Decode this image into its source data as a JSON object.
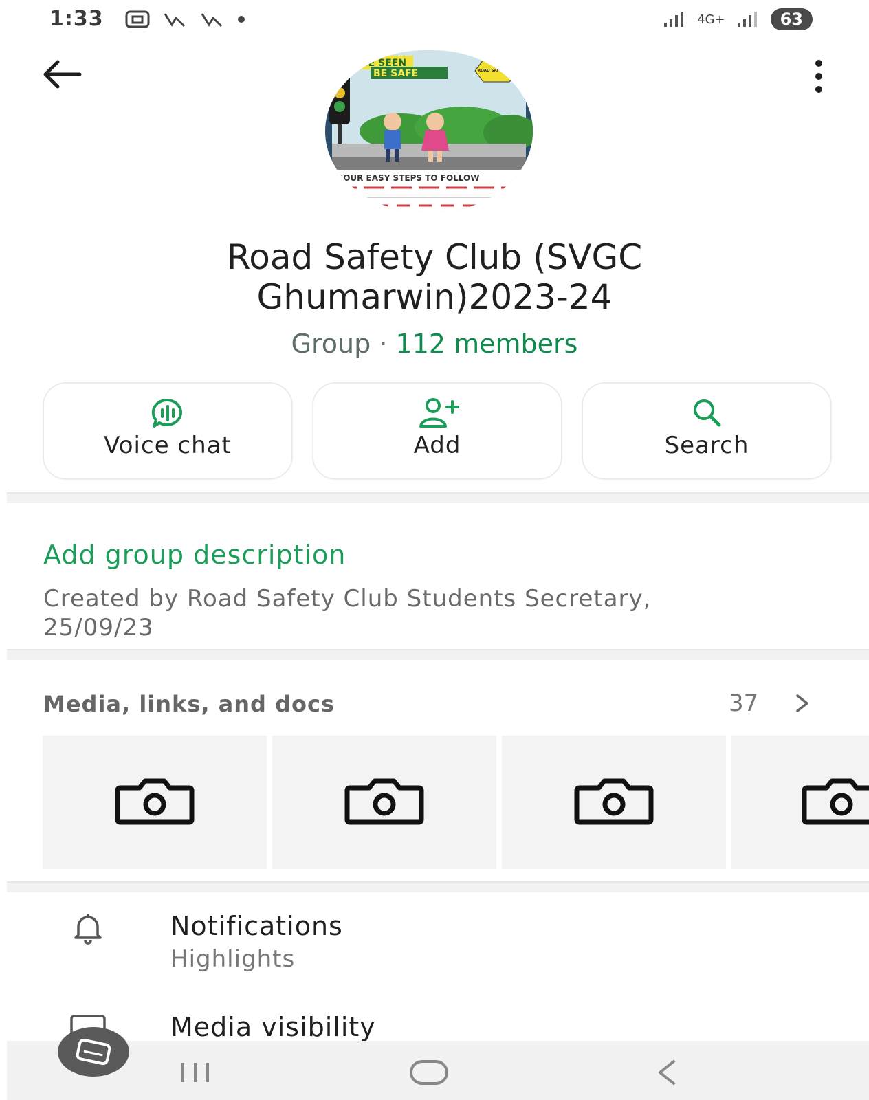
{
  "status_bar": {
    "time": "1:33",
    "network": "4G+",
    "battery": "63"
  },
  "group": {
    "title": "Road Safety Club (SVGC Ghumarwin)2023-24",
    "type_label": "Group",
    "separator": "·",
    "members": "112 members"
  },
  "avatar_art": {
    "banner_line1": "BE SEEN",
    "banner_line2": "BE SAFE",
    "badge": "ROAD SAFETY RULES",
    "caption": "FOUR EASY STEPS TO FOLLOW"
  },
  "actions": [
    {
      "label": "Voice chat",
      "icon": "voice-chat-icon"
    },
    {
      "label": "Add",
      "icon": "add-person-icon"
    },
    {
      "label": "Search",
      "icon": "search-icon"
    }
  ],
  "description": {
    "add_label": "Add group description",
    "created_by": "Created by Road Safety Club Students Secretary, 25/09/23"
  },
  "media": {
    "title": "Media, links, and docs",
    "count": "37"
  },
  "settings": [
    {
      "title": "Notifications",
      "subtitle": "Highlights",
      "icon": "bell-icon"
    },
    {
      "title": "Media visibility",
      "icon": "image-icon"
    }
  ],
  "colors": {
    "accent": "#1a9e59",
    "members": "#108c4e"
  }
}
